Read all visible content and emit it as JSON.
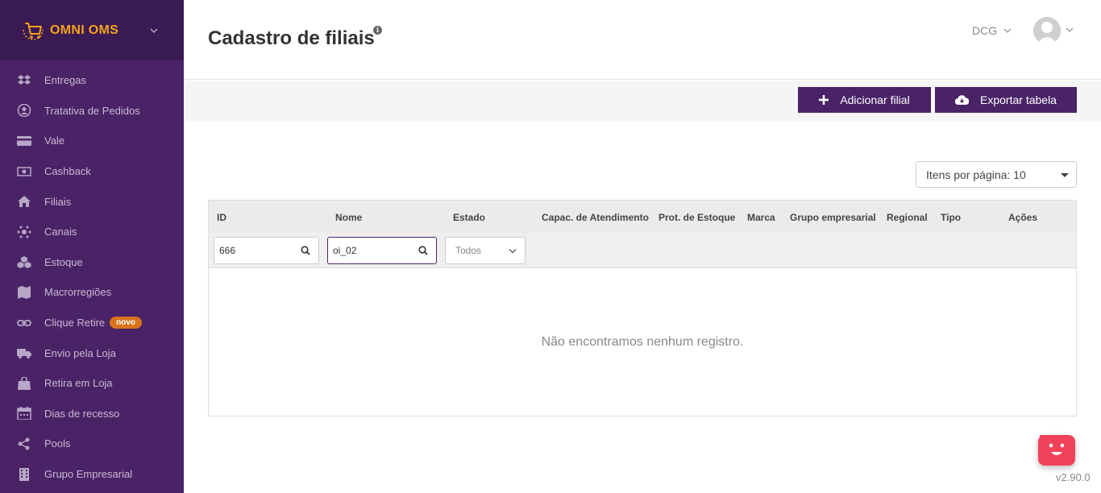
{
  "sidebar": {
    "brand": "OMNI OMS",
    "items": [
      {
        "label": "Entregas",
        "icon": "dropbox-icon"
      },
      {
        "label": "Tratativa de Pedidos",
        "icon": "user-circle-icon"
      },
      {
        "label": "Vale",
        "icon": "credit-card-icon"
      },
      {
        "label": "Cashback",
        "icon": "money-icon"
      },
      {
        "label": "Filiais",
        "icon": "home-icon"
      },
      {
        "label": "Canais",
        "icon": "network-icon"
      },
      {
        "label": "Estoque",
        "icon": "cubes-icon"
      },
      {
        "label": "Macrorregiões",
        "icon": "map-icon"
      },
      {
        "label": "Clique Retire",
        "icon": "link-icon",
        "badge": "novo"
      },
      {
        "label": "Envio pela Loja",
        "icon": "truck-icon"
      },
      {
        "label": "Retira em Loja",
        "icon": "shopping-bag-icon"
      },
      {
        "label": "Dias de recesso",
        "icon": "calendar-icon"
      },
      {
        "label": "Pools",
        "icon": "share-icon"
      },
      {
        "label": "Grupo Empresarial",
        "icon": "building-icon"
      }
    ]
  },
  "header": {
    "title": "Cadastro de filiais",
    "org": "DCG"
  },
  "toolbar": {
    "add_label": "Adicionar filial",
    "export_label": "Exportar tabela"
  },
  "pagination": {
    "per_page_label": "Itens por página: 10"
  },
  "table": {
    "columns": [
      "ID",
      "Nome",
      "Estado",
      "Capac. de Atendimento",
      "Prot. de Estoque",
      "Marca",
      "Grupo empresarial",
      "Regional",
      "Tipo",
      "Ações"
    ],
    "filters": {
      "id": "666",
      "nome": "oi_02",
      "estado": "Todos"
    },
    "empty_message": "Não encontramos nenhum registro."
  },
  "footer": {
    "version": "v2.90.0"
  },
  "colors": {
    "sidebar_bg": "#4a2366",
    "sidebar_brand_bg": "#3a1a52",
    "accent": "#4a2366",
    "brand_orange": "#f4a21c",
    "badge": "#d9721a",
    "chat": "#f0435a"
  }
}
